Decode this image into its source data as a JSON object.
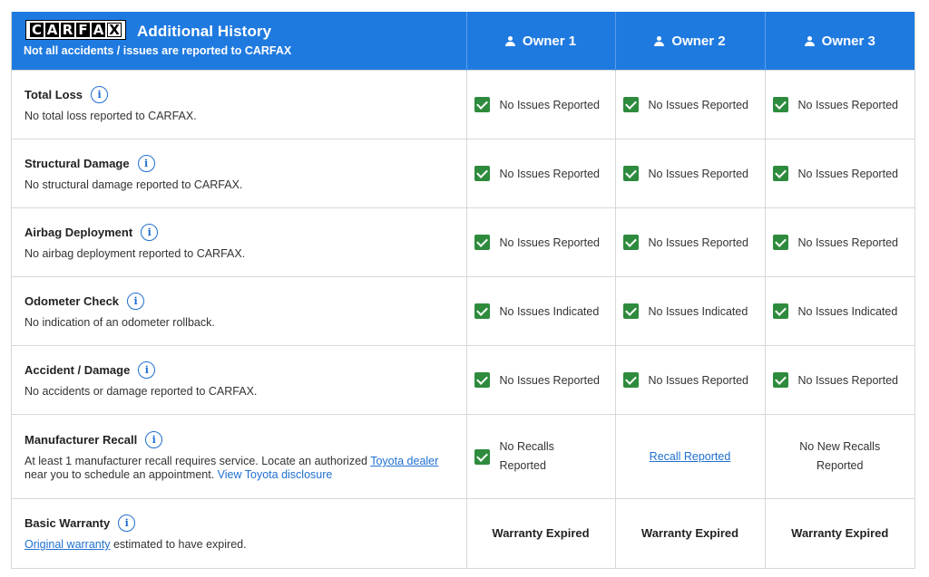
{
  "header": {
    "logo_letters": [
      "C",
      "A",
      "R",
      "F",
      "A",
      "X"
    ],
    "title": "Additional History",
    "subtitle": "Not all accidents / issues are reported to CARFAX",
    "owners": [
      "Owner 1",
      "Owner 2",
      "Owner 3"
    ],
    "owner_icon": "person-icon",
    "accent_color": "#1f7ae0",
    "check_color": "#2e8b3d"
  },
  "rows": {
    "total_loss": {
      "title": "Total Loss",
      "desc": "No total loss reported to CARFAX.",
      "owners": [
        "No Issues Reported",
        "No Issues Reported",
        "No Issues Reported"
      ]
    },
    "structural": {
      "title": "Structural Damage",
      "desc": "No structural damage reported to CARFAX.",
      "owners": [
        "No Issues Reported",
        "No Issues Reported",
        "No Issues Reported"
      ]
    },
    "airbag": {
      "title": "Airbag Deployment",
      "desc": "No airbag deployment reported to CARFAX.",
      "owners": [
        "No Issues Reported",
        "No Issues Reported",
        "No Issues Reported"
      ]
    },
    "odometer": {
      "title": "Odometer Check",
      "desc": "No indication of an odometer rollback.",
      "owners": [
        "No Issues Indicated",
        "No Issues Indicated",
        "No Issues Indicated"
      ]
    },
    "accident": {
      "title": "Accident / Damage",
      "desc": "No accidents or damage reported to CARFAX.",
      "owners": [
        "No Issues Reported",
        "No Issues Reported",
        "No Issues Reported"
      ]
    },
    "recall": {
      "title": "Manufacturer Recall",
      "desc_prefix": "At least 1 manufacturer recall requires service. Locate an authorized ",
      "desc_link": "Toyota dealer",
      "desc_mid": " near you to schedule an appointment. ",
      "desc_link2": "View Toyota disclosure",
      "owner1": "No Recalls Reported",
      "owner2": "Recall Reported",
      "owner3": "No New Recalls Reported"
    },
    "warranty": {
      "title": "Basic Warranty",
      "desc_link": "Original warranty",
      "desc_suffix": " estimated to have expired.",
      "owners": [
        "Warranty Expired",
        "Warranty Expired",
        "Warranty Expired"
      ]
    }
  }
}
